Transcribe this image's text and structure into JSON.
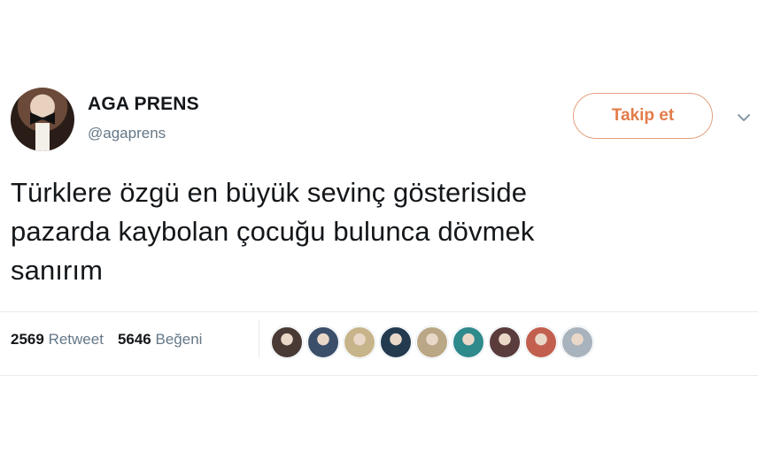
{
  "user": {
    "name": "AGA PRENS",
    "handle": "@agaprens"
  },
  "follow_button": {
    "label": "Takip et"
  },
  "tweet": {
    "text": "Türklere özgü en büyük sevinç gösteriside\npazarda kaybolan çocuğu bulunca dövmek\nsanırım"
  },
  "stats": {
    "retweets": {
      "count": "2569",
      "label": "Retweet"
    },
    "likes": {
      "count": "5646",
      "label": "Beğeni"
    }
  },
  "likers": [
    {
      "color": "#4a3a36"
    },
    {
      "color": "#3b4f6a"
    },
    {
      "color": "#c8b48a"
    },
    {
      "color": "#233a4f"
    },
    {
      "color": "#b9a785"
    },
    {
      "color": "#2f8a8c"
    },
    {
      "color": "#5a3c3c"
    },
    {
      "color": "#c25f4e"
    },
    {
      "color": "#a9b3bd"
    }
  ],
  "colors": {
    "accent": "#e37c4a",
    "secondary_text": "#657786",
    "primary_text": "#14171a"
  }
}
